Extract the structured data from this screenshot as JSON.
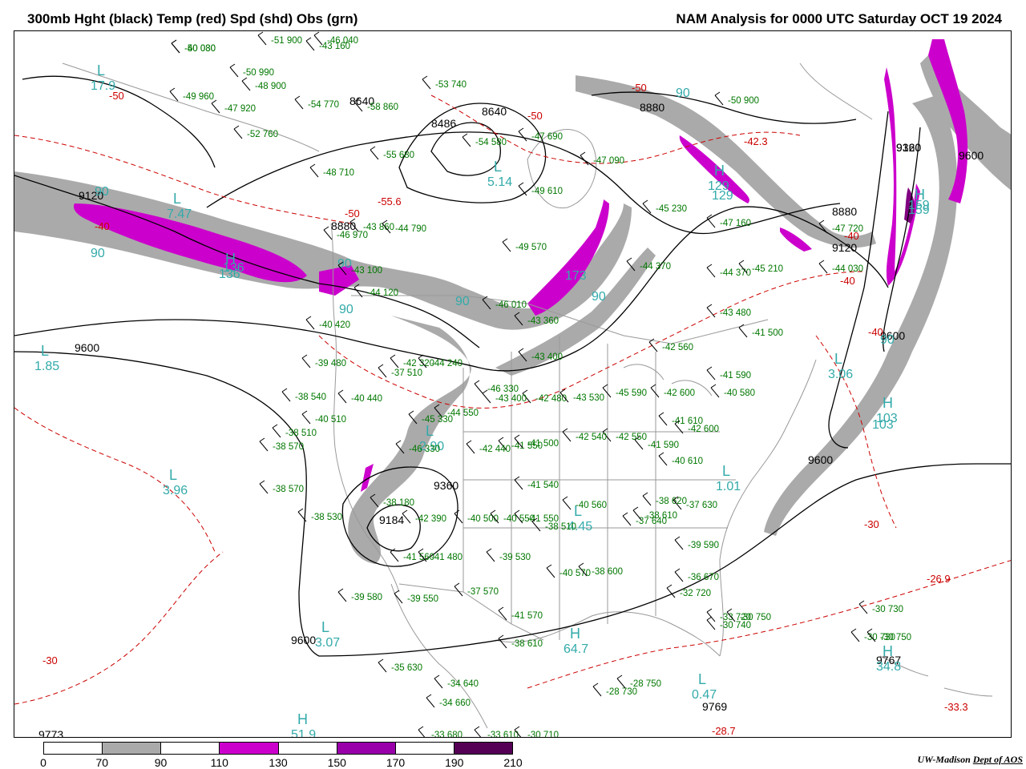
{
  "header": {
    "left_title": "300mb Hght (black) Temp (red) Spd (shd) Obs (grn)",
    "right_title": "NAM Analysis for 0000 UTC Saturday  OCT 19 2024"
  },
  "colors": {
    "height_contour": "#000000",
    "temp_contour": "#cc0000",
    "obs_text": "#007700",
    "wind_label": "#33aaaa",
    "border": "#999999",
    "speed_70_90": "#aaaaaa",
    "speed_110_130": "#cc00cc",
    "speed_130_150": "#9900aa",
    "speed_150_170": "#800080",
    "speed_190_210": "#550055"
  },
  "colorbar": {
    "ticks": [
      "0",
      "70",
      "90",
      "110",
      "130",
      "150",
      "170",
      "190",
      "210"
    ],
    "fills": [
      "#ffffff",
      "#aaaaaa",
      "#ffffff",
      "#cc00cc",
      "#ffffff",
      "#9900aa",
      "#ffffff",
      "#550055"
    ]
  },
  "credit": {
    "org": "UW-Madison",
    "dept": "Dept of AOS"
  },
  "map": {
    "height_labels": [
      "9120",
      "8880",
      "8640",
      "8640",
      "8486",
      "8880",
      "8880",
      "9120",
      "9120",
      "9360",
      "9600",
      "9600",
      "9600",
      "9600",
      "9360",
      "9184",
      "9600",
      "9767",
      "9769",
      "9773"
    ],
    "temp_labels": [
      "-50",
      "-50",
      "-50",
      "-50",
      "-40",
      "-40",
      "-40",
      "-40",
      "-30",
      "-30",
      "-55.6",
      "-42.3",
      "-26.9",
      "-33.3",
      "-28.7"
    ],
    "speed_labels": [
      "90",
      "90",
      "90",
      "90",
      "90",
      "90",
      "90",
      "90",
      "136",
      "173",
      "129",
      "159",
      "103"
    ],
    "pressure_centers": [
      {
        "letter": "L",
        "value": "17.9"
      },
      {
        "letter": "L",
        "value": "7.47"
      },
      {
        "letter": "H",
        "value": "136"
      },
      {
        "letter": "L",
        "value": "5.14"
      },
      {
        "letter": "L",
        "value": "1.85"
      },
      {
        "letter": "L",
        "value": "3.96"
      },
      {
        "letter": "L",
        "value": "2.90"
      },
      {
        "letter": "L",
        "value": "3.07"
      },
      {
        "letter": "H",
        "value": "51.9"
      },
      {
        "letter": "H",
        "value": "64.7"
      },
      {
        "letter": "L",
        "value": "4.45"
      },
      {
        "letter": "L",
        "value": "1.01"
      },
      {
        "letter": "L",
        "value": "0.47"
      },
      {
        "letter": "L",
        "value": "3.06"
      },
      {
        "letter": "H",
        "value": "103"
      },
      {
        "letter": "H",
        "value": "34.8"
      },
      {
        "letter": "H",
        "value": "159"
      },
      {
        "letter": "H",
        "value": "129"
      }
    ],
    "observations": [
      "-50 080",
      "-50 990",
      "-51 900",
      "-46 040",
      "-49 960",
      "-47 920",
      "-52 760",
      "-54 770",
      "-58 860",
      "-55 680",
      "-54 580",
      "-53 740",
      "-47 690",
      "-47 090",
      "-49 610",
      "-49 570",
      "-45 230",
      "-47 160",
      "-44 370",
      "-44 370",
      "-43 480",
      "-41 500",
      "-42 560",
      "-41 590",
      "-40 580",
      "-42 600",
      "-41 610",
      "-42 600",
      "-41 590",
      "-40 610",
      "-43 360",
      "-43 400",
      "-42 480",
      "-43 530",
      "-42 550",
      "-45 590",
      "-42 540",
      "-41 550",
      "-41 540",
      "-41 500",
      "-42 440",
      "-46 330",
      "-43 400",
      "-44 550",
      "-45 330",
      "-46 330",
      "-42 320",
      "-44 240",
      "-40 440",
      "-40 510",
      "-38 540",
      "-39 480",
      "-40 420",
      "-38 510",
      "-38 570",
      "-38 570",
      "-38 530",
      "-38 180",
      "-42 390",
      "-40 500",
      "-40 550",
      "-41 550",
      "-38 510",
      "-40 560",
      "-41 560",
      "-41 480",
      "-39 530",
      "-40 570",
      "-38 600",
      "-37 640",
      "-38 610",
      "-38 620",
      "-39 590",
      "-37 630",
      "-36 670",
      "-32 720",
      "-33 720",
      "-30 740",
      "-30 750",
      "-39 580",
      "-39 550",
      "-37 570",
      "-41 570",
      "-38 610",
      "-35 630",
      "-34 640",
      "-34 660",
      "-33 680",
      "-33 610",
      "-30 710",
      "-28 730",
      "-28 750",
      "-30 730",
      "-30 730",
      "-30 750",
      "-37 510",
      "-44 120",
      "-43 100",
      "-46 970",
      "-43 860",
      "-44 790",
      "-48 710",
      "-44 030",
      "-45 210",
      "-43 160",
      "-48 900",
      "-50 900",
      "-47 720",
      "-46 010",
      "-40 030"
    ]
  }
}
